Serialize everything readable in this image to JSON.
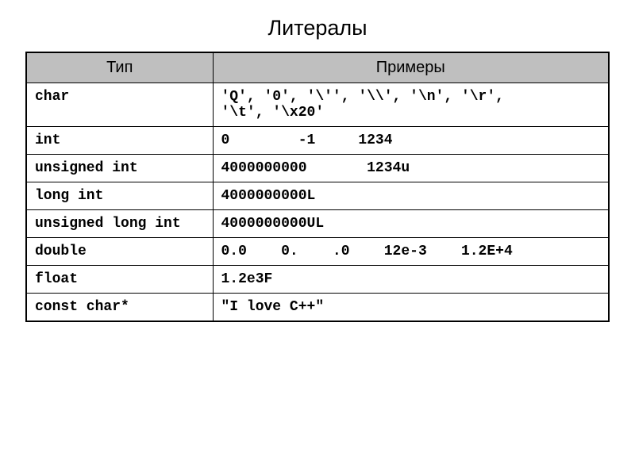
{
  "title": "Литералы",
  "headers": {
    "type": "Тип",
    "examples": "Примеры"
  },
  "rows": [
    {
      "type": "char",
      "examples": "'Q', '0', '\\'', '\\\\', '\\n', '\\r',\n'\\t', '\\x20'"
    },
    {
      "type": "int",
      "examples": "0        -1     1234"
    },
    {
      "type": "unsigned int",
      "examples": "4000000000       1234u"
    },
    {
      "type": "long int",
      "examples": "4000000000L"
    },
    {
      "type": "unsigned long int",
      "examples": "4000000000UL"
    },
    {
      "type": "double",
      "examples": "0.0    0.    .0    12e-3    1.2E+4"
    },
    {
      "type": "float",
      "examples": "1.2e3F"
    },
    {
      "type": "const char*",
      "examples": "\"I love C++\""
    }
  ]
}
